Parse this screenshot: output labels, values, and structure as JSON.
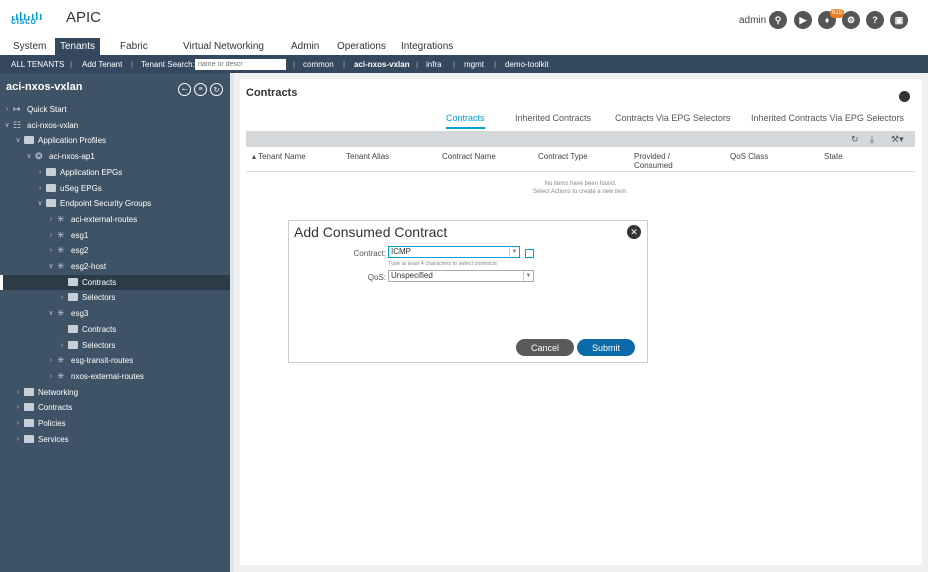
{
  "header": {
    "brand": "cisco",
    "app_title": "APIC",
    "user": "admin",
    "notification_count": "615",
    "icons": [
      "search-icon",
      "video-icon",
      "bell-icon",
      "gear-icon",
      "help-icon",
      "monitor-icon"
    ]
  },
  "main_tabs": [
    "System",
    "Tenants",
    "Fabric",
    "Virtual Networking",
    "Admin",
    "Operations",
    "Integrations"
  ],
  "active_tab": "Tenants",
  "subnav": {
    "all_tenants": "ALL TENANTS",
    "add_tenant": "Add Tenant",
    "tenant_search_label": "Tenant Search:",
    "tenant_search_placeholder": "name or descr",
    "tenants": [
      "common",
      "aci-nxos-vxlan",
      "infra",
      "mgmt",
      "demo-toolkit"
    ]
  },
  "sidebar": {
    "title": "aci-nxos-vxlan",
    "tree": [
      {
        "label": "Quick Start",
        "depth": 0,
        "icon": "quickstart-icon",
        "chev": "right"
      },
      {
        "label": "aci-nxos-vxlan",
        "depth": 0,
        "icon": "tenant-icon",
        "chev": "down"
      },
      {
        "label": "Application Profiles",
        "depth": 1,
        "icon": "folder-icon",
        "chev": "down"
      },
      {
        "label": "aci-nxos-ap1",
        "depth": 2,
        "icon": "app-profile-icon",
        "chev": "down"
      },
      {
        "label": "Application EPGs",
        "depth": 3,
        "icon": "folder-icon",
        "chev": "right"
      },
      {
        "label": "uSeg EPGs",
        "depth": 3,
        "icon": "folder-icon",
        "chev": "right"
      },
      {
        "label": "Endpoint Security Groups",
        "depth": 3,
        "icon": "folder-icon",
        "chev": "down"
      },
      {
        "label": "aci-external-routes",
        "depth": 4,
        "icon": "esg-icon",
        "chev": "right"
      },
      {
        "label": "esg1",
        "depth": 4,
        "icon": "esg-icon",
        "chev": "right"
      },
      {
        "label": "esg2",
        "depth": 4,
        "icon": "esg-icon",
        "chev": "right"
      },
      {
        "label": "esg2-host",
        "depth": 4,
        "icon": "esg-icon",
        "chev": "down"
      },
      {
        "label": "Contracts",
        "depth": 5,
        "icon": "folder-icon",
        "chev": "",
        "selected": true
      },
      {
        "label": "Selectors",
        "depth": 5,
        "icon": "folder-icon",
        "chev": "right"
      },
      {
        "label": "esg3",
        "depth": 4,
        "icon": "esg-icon",
        "chev": "down"
      },
      {
        "label": "Contracts",
        "depth": 5,
        "icon": "folder-icon",
        "chev": ""
      },
      {
        "label": "Selectors",
        "depth": 5,
        "icon": "folder-icon",
        "chev": "right"
      },
      {
        "label": "esg-transit-routes",
        "depth": 4,
        "icon": "esg-icon",
        "chev": "right"
      },
      {
        "label": "nxos-external-routes",
        "depth": 4,
        "icon": "esg-icon",
        "chev": "right"
      },
      {
        "label": "Networking",
        "depth": 1,
        "icon": "folder-icon",
        "chev": "right"
      },
      {
        "label": "Contracts",
        "depth": 1,
        "icon": "folder-icon",
        "chev": "right"
      },
      {
        "label": "Policies",
        "depth": 1,
        "icon": "folder-icon",
        "chev": "right"
      },
      {
        "label": "Services",
        "depth": 1,
        "icon": "folder-icon",
        "chev": "right"
      }
    ]
  },
  "content": {
    "title": "Contracts",
    "subtabs": [
      "Contracts",
      "Inherited Contracts",
      "Contracts Via EPG Selectors",
      "Inherited Contracts Via EPG Selectors"
    ],
    "active_subtab": "Contracts",
    "columns": [
      "Tenant Name",
      "Tenant Alias",
      "Contract Name",
      "Contract Type",
      "Provided / Consumed",
      "QoS Class",
      "State"
    ],
    "empty_line1": "No items have been found.",
    "empty_line2": "Select Actions to create a new item."
  },
  "dialog": {
    "title": "Add Consumed Contract",
    "contract_label": "Contract:",
    "contract_value": "ICMP",
    "contract_hint": "Type at least 4 characters to select contracts",
    "qos_label": "QoS:",
    "qos_value": "Unspecified",
    "cancel_label": "Cancel",
    "submit_label": "Submit"
  },
  "colors": {
    "nav_bg": "#34495e",
    "sidebar_bg": "#3e5365",
    "accent": "#049fd9",
    "submit": "#0d6aa8"
  }
}
